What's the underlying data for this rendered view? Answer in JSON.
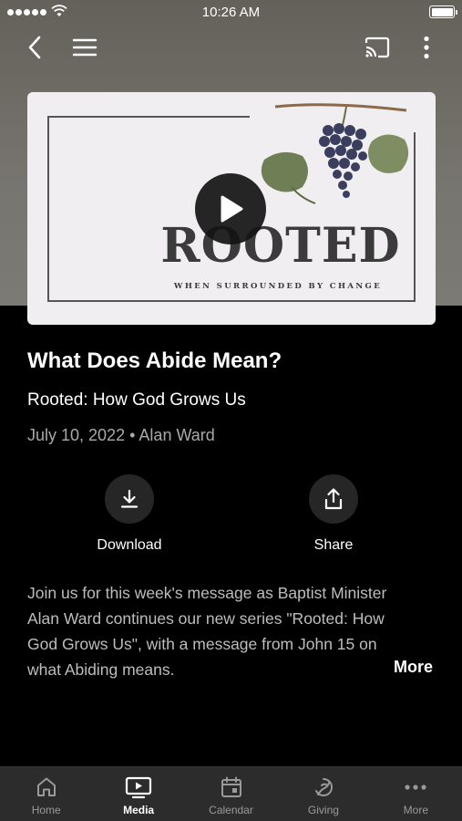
{
  "status_bar": {
    "time": "10:26 AM"
  },
  "header": {
    "back_icon": "chevron-left-icon",
    "menu_icon": "hamburger-icon",
    "cast_icon": "cast-icon",
    "overflow_icon": "more-vertical-icon"
  },
  "hero": {
    "artwork_title": "ROOTED",
    "artwork_subtitle": "WHEN SURROUNDED BY CHANGE",
    "play_icon": "play-icon"
  },
  "sermon": {
    "title": "What Does Abide Mean?",
    "series": "Rooted: How God Grows Us",
    "date": "July 10, 2022",
    "separator": "•",
    "speaker": "Alan Ward",
    "description": "Join us for this week's message as Baptist Minister Alan Ward continues our new series \"Rooted: How God Grows Us\", with a message from John 15 on what Abiding means.",
    "more_label": "More"
  },
  "actions": [
    {
      "label": "Download",
      "icon": "download-icon"
    },
    {
      "label": "Share",
      "icon": "share-icon"
    }
  ],
  "tabs": [
    {
      "label": "Home",
      "icon": "home-icon",
      "active": false
    },
    {
      "label": "Media",
      "icon": "tv-play-icon",
      "active": true
    },
    {
      "label": "Calendar",
      "icon": "calendar-icon",
      "active": false
    },
    {
      "label": "Giving",
      "icon": "giving-icon",
      "active": false
    },
    {
      "label": "More",
      "icon": "more-horizontal-icon",
      "active": false
    }
  ],
  "colors": {
    "header_bg": "#77756f",
    "body_bg": "#000000",
    "tabbar_bg": "#2c2c2c",
    "action_circle": "#262626",
    "muted_text": "#a9a9a9"
  }
}
